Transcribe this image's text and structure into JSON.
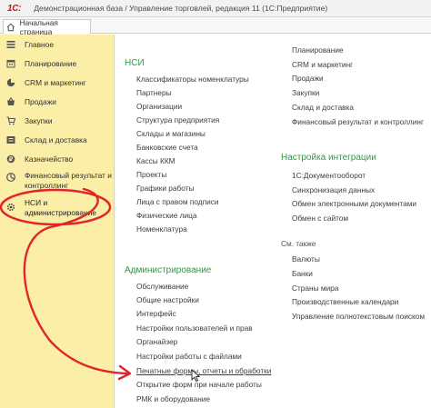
{
  "window": {
    "logo": "1С:",
    "title": "Демонстрационная база / Управление торговлей, редакция 11  (1С:Предприятие)"
  },
  "tabs": {
    "home_label": "Начальная страница"
  },
  "sidebar": {
    "items": [
      {
        "label": "Главное",
        "icon": "list-icon"
      },
      {
        "label": "Планирование",
        "icon": "calendar-icon"
      },
      {
        "label": "CRM и маркетинг",
        "icon": "crm-icon"
      },
      {
        "label": "Продажи",
        "icon": "basket-icon"
      },
      {
        "label": "Закупки",
        "icon": "cart-icon"
      },
      {
        "label": "Склад и доставка",
        "icon": "warehouse-icon"
      },
      {
        "label": "Казначейство",
        "icon": "coins-icon"
      },
      {
        "label_line1": "Финансовый результат и",
        "label_line2": "контроллинг",
        "icon": "chart-icon"
      },
      {
        "label_line1": "НСИ и",
        "label_line2": "администрирование",
        "icon": "gear-icon"
      }
    ]
  },
  "content": {
    "nsi": {
      "title": "НСИ",
      "links": [
        "Классификаторы номенклатуры",
        "Партнеры",
        "Организации",
        "Структура предприятия",
        "Склады и магазины",
        "Банковские счета",
        "Кассы ККМ",
        "Проекты",
        "Графики работы",
        "Лица с правом подписи",
        "Физические лица",
        "Номенклатура"
      ]
    },
    "admin": {
      "title": "Администрирование",
      "links": [
        "Обслуживание",
        "Общие настройки",
        "Интерфейс",
        "Настройки пользователей и прав",
        "Органайзер",
        "Настройки работы с файлами",
        "Печатные формы, отчеты и обработки",
        "Открытие форм при начале работы",
        "РМК и оборудование"
      ]
    },
    "right_top": {
      "links": [
        "Планирование",
        "CRM и маркетинг",
        "Продажи",
        "Закупки",
        "Склад и доставка",
        "Финансовый результат и контроллинг"
      ]
    },
    "integration": {
      "title": "Настройка интеграции",
      "links": [
        "1С:Документооборот",
        "Синхронизация данных",
        "Обмен электронными документами",
        "Обмен с сайтом"
      ]
    },
    "see_also": {
      "title": "См. также",
      "links": [
        "Валюты",
        "Банки",
        "Страны мира",
        "Производственные календари",
        "Управление полнотекстовым поиском"
      ]
    }
  },
  "colors": {
    "sidebar_bg": "#fbeea6",
    "section_green": "#2f9a43",
    "annotation_red": "#e2242b",
    "logo_red": "#d4141a"
  }
}
